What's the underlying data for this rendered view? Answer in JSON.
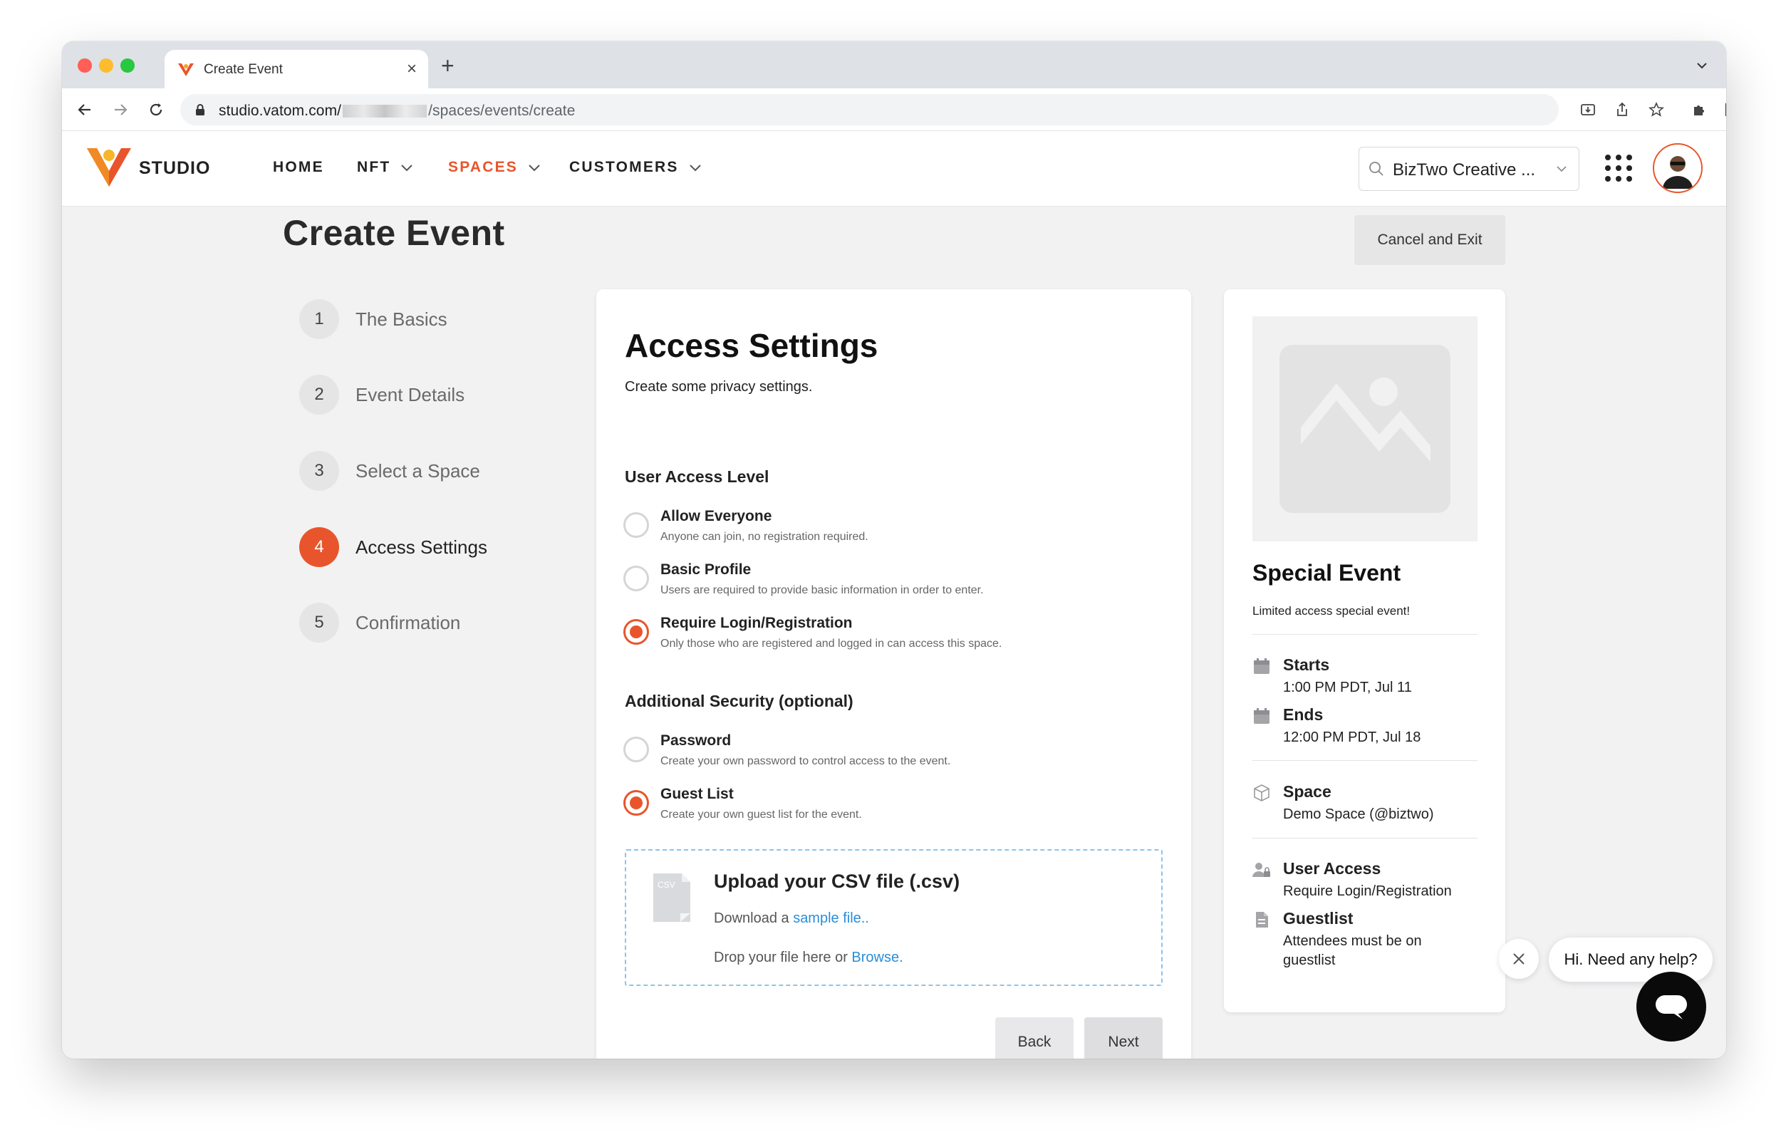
{
  "browser": {
    "tab_title": "Create Event",
    "url_host": "studio.vatom.com/",
    "url_path": "/spaces/events/create",
    "colors": {
      "close": "#ff5f57",
      "minimize": "#febc2e",
      "zoom": "#28c840"
    }
  },
  "header": {
    "logo_text": "STUDIO",
    "nav": [
      {
        "label": "HOME",
        "has_dropdown": false,
        "active": false
      },
      {
        "label": "NFT",
        "has_dropdown": true,
        "active": false
      },
      {
        "label": "SPACES",
        "has_dropdown": true,
        "active": true
      },
      {
        "label": "CUSTOMERS",
        "has_dropdown": true,
        "active": false
      }
    ],
    "org_selector": "BizTwo Creative ...",
    "accent": "#e8552c"
  },
  "page": {
    "title": "Create Event",
    "cancel_label": "Cancel and Exit"
  },
  "steps": [
    {
      "number": "1",
      "label": "The Basics"
    },
    {
      "number": "2",
      "label": "Event Details"
    },
    {
      "number": "3",
      "label": "Select a Space"
    },
    {
      "number": "4",
      "label": "Access Settings",
      "active": true
    },
    {
      "number": "5",
      "label": "Confirmation"
    }
  ],
  "access": {
    "title": "Access Settings",
    "subtitle": "Create some privacy settings.",
    "user_level_heading": "User Access Level",
    "user_levels": [
      {
        "label": "Allow Everyone",
        "desc": "Anyone can join, no registration required.",
        "selected": false
      },
      {
        "label": "Basic Profile",
        "desc": "Users are required to provide basic information in order to enter.",
        "selected": false
      },
      {
        "label": "Require Login/Registration",
        "desc": "Only those who are registered and logged in can access this space.",
        "selected": true
      }
    ],
    "security_heading": "Additional Security (optional)",
    "security": [
      {
        "label": "Password",
        "desc": "Create your own password to control access to the event.",
        "selected": false
      },
      {
        "label": "Guest List",
        "desc": "Create your own guest list for the event.",
        "selected": true
      }
    ],
    "upload": {
      "icon_text": "CSV",
      "title": "Upload your CSV file (.csv)",
      "download_prefix": "Download a ",
      "download_link": "sample file..",
      "drop_prefix": "Drop your file here or ",
      "drop_link": "Browse."
    },
    "back_label": "Back",
    "next_label": "Next"
  },
  "summary": {
    "title": "Special Event",
    "description": "Limited access special event!",
    "starts_label": "Starts",
    "starts_value": "1:00 PM PDT, Jul 11",
    "ends_label": "Ends",
    "ends_value": "12:00 PM PDT, Jul 18",
    "space_label": "Space",
    "space_value": "Demo Space (@biztwo)",
    "user_access_label": "User Access",
    "user_access_value": "Require Login/Registration",
    "guestlist_label": "Guestlist",
    "guestlist_value": "Attendees must be on guestlist"
  },
  "help": {
    "bubble": "Hi. Need any help?"
  }
}
